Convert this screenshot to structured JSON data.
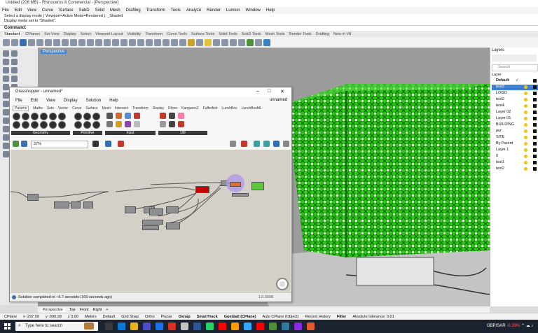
{
  "rhino": {
    "title": "Untitled (206 MB) - Rhinoceros 8 Commercial - [Perspective]",
    "menu": [
      "File",
      "Edit",
      "View",
      "Curve",
      "Surface",
      "SubD",
      "Solid",
      "Mesh",
      "Drafting",
      "Transform",
      "Tools",
      "Analyze",
      "Render",
      "Lumion",
      "Window",
      "Help"
    ],
    "command_history": [
      "Select a display mode ( Viewport=Active  Mode=Rendered ): _Shaded",
      "Display mode set to \"Shaded\"."
    ],
    "command_prompt": "Command:",
    "toolbar_tabs": [
      "Standard",
      "CPlanes",
      "Set View",
      "Display",
      "Select",
      "Viewport Layout",
      "Visibility",
      "Transform",
      "Curve Tools",
      "Surface Tools",
      "Solid Tools",
      "SubD Tools",
      "Mesh Tools",
      "Render Tools",
      "Drafting",
      "New in V8"
    ],
    "viewport_label": "Perspective",
    "viewport_tabs": [
      "Perspective",
      "Top",
      "Front",
      "Right",
      "+"
    ]
  },
  "layers": {
    "title": "Layers",
    "search_placeholder": "Search",
    "column_header": "Layer",
    "rows": [
      {
        "name": "Default",
        "check": "✓"
      },
      {
        "name": "test3",
        "selected": true
      },
      {
        "name": "LOGO"
      },
      {
        "name": "test2"
      },
      {
        "name": "test4"
      },
      {
        "name": "Layer 02"
      },
      {
        "name": "Layer 01"
      },
      {
        "name": "BUILDING"
      },
      {
        "name": "pur"
      },
      {
        "name": "SITE"
      },
      {
        "name": "By Parent"
      },
      {
        "name": "Layer 1"
      },
      {
        "name": "0"
      },
      {
        "name": "test1"
      },
      {
        "name": "test2"
      }
    ]
  },
  "grasshopper": {
    "title": "Grasshopper - unnamed*",
    "menu": [
      "File",
      "Edit",
      "View",
      "Display",
      "Solution",
      "Help"
    ],
    "document_name": "unnamed",
    "tabs": [
      "Params",
      "Maths",
      "Sets",
      "Vector",
      "Curve",
      "Surface",
      "Mesh",
      "Intersect",
      "Transform",
      "Display",
      "Rhino",
      "Kangaroo2",
      "Fufferfish",
      "LunchBox",
      "LunchBoxML"
    ],
    "ribbon_groups": [
      "Geometry",
      "Primitive",
      "Input",
      "Util"
    ],
    "zoom_value": "27%",
    "status_message": "Solution completed in ~6.7 seconds (100 seconds ago)",
    "version": "1.0.0008"
  },
  "status_bar": {
    "cplane": "CPlane",
    "x": "x -297.59",
    "y": "y -590.28",
    "z": "z 0.00",
    "units": "Meters",
    "layer": "Default",
    "toggles": [
      "Grid Snap",
      "Ortho",
      "Planar",
      "Osnap",
      "SmartTrack",
      "Gumball (CPlane)",
      "Auto CPlane (Object)",
      "Record History",
      "Filter"
    ],
    "tolerance": "Absolute tolerance: 0.01"
  },
  "taskbar": {
    "search_placeholder": "Type here to search",
    "currency": "GBP/SAR",
    "change": "-0.39%"
  },
  "colors": {
    "building_green": "#2fc41a",
    "selection_blue": "#3c7fd4",
    "gh_canvas": "#d4d0c8"
  }
}
